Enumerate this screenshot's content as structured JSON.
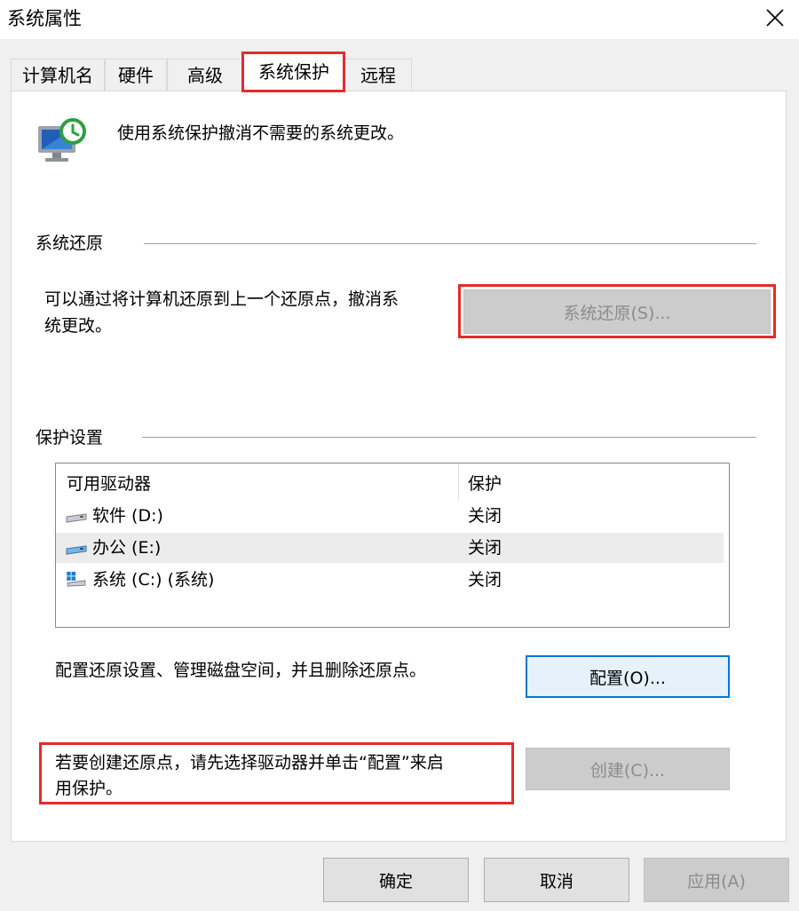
{
  "window": {
    "title": "系统属性"
  },
  "tabs": [
    {
      "label": "计算机名"
    },
    {
      "label": "硬件"
    },
    {
      "label": "高级"
    },
    {
      "label": "系统保护",
      "active": true
    },
    {
      "label": "远程"
    }
  ],
  "intro": {
    "text": "使用系统保护撤消不需要的系统更改。"
  },
  "restore": {
    "section": "系统还原",
    "desc_line1": "可以通过将计算机还原到上一个还原点，撤消系",
    "desc_line2": "统更改。",
    "button": "系统还原(S)..."
  },
  "protection": {
    "section": "保护设置",
    "columns": {
      "drive": "可用驱动器",
      "protection": "保护"
    },
    "rows": [
      {
        "drive": "软件 (D:)",
        "status": "关闭",
        "icon": "drive-icon"
      },
      {
        "drive": "办公 (E:)",
        "status": "关闭",
        "icon": "drive-icon"
      },
      {
        "drive": "系统 (C:) (系统)",
        "status": "关闭",
        "icon": "windows-drive-icon"
      }
    ],
    "configure_text": "配置还原设置、管理磁盘空间，并且删除还原点。",
    "configure_button": "配置(O)...",
    "create_line1": "若要创建还原点，请先选择驱动器并单击“配置”来启",
    "create_line2": "用保护。",
    "create_button": "创建(C)..."
  },
  "footer": {
    "ok": "确定",
    "cancel": "取消",
    "apply": "应用(A)"
  },
  "colors": {
    "highlight": "#e52a2a",
    "accent": "#0078d7"
  }
}
